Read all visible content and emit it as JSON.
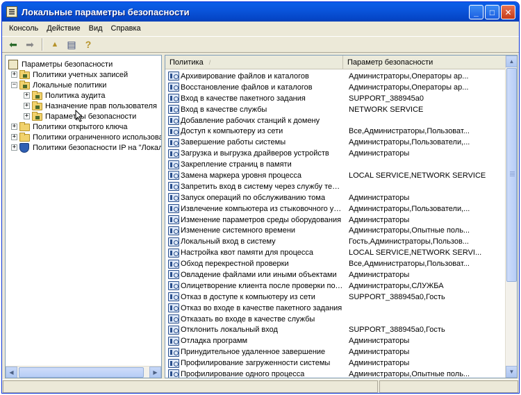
{
  "window": {
    "title": "Локальные параметры безопасности",
    "minimize_glyph": "_",
    "maximize_glyph": "□",
    "close_glyph": "✕"
  },
  "menu": [
    "Консоль",
    "Действие",
    "Вид",
    "Справка"
  ],
  "toolbar": {
    "back_glyph": "⬅",
    "forward_glyph": "➡",
    "up_glyph": "▲",
    "export_glyph": "▤",
    "help_glyph": "?"
  },
  "tree": {
    "root": "Параметры безопасности",
    "items": [
      {
        "label": "Политики учетных записей",
        "expander": "+"
      },
      {
        "label": "Локальные политики",
        "expander": "−"
      },
      {
        "label": "Политика аудита",
        "expander": "+"
      },
      {
        "label": "Назначение прав пользователя",
        "expander": "+"
      },
      {
        "label": "Параметры безопасности",
        "expander": "+"
      },
      {
        "label": "Политики открытого ключа",
        "expander": "+"
      },
      {
        "label": "Политики ограниченного использован",
        "expander": "+"
      },
      {
        "label": "Политики безопасности IP на \"Локальн",
        "expander": "+"
      }
    ]
  },
  "list": {
    "col_policy": "Политика",
    "col_setting": "Параметр безопасности",
    "rows": [
      {
        "policy": "Архивирование файлов и каталогов",
        "setting": "Администраторы,Операторы ар..."
      },
      {
        "policy": "Восстановление файлов и каталогов",
        "setting": "Администраторы,Операторы ар..."
      },
      {
        "policy": "Вход в качестве пакетного задания",
        "setting": "SUPPORT_388945a0"
      },
      {
        "policy": "Вход в качестве службы",
        "setting": "NETWORK SERVICE"
      },
      {
        "policy": "Добавление рабочих станций к домену",
        "setting": ""
      },
      {
        "policy": "Доступ к компьютеру из сети",
        "setting": "Все,Администраторы,Пользоват..."
      },
      {
        "policy": "Завершение работы системы",
        "setting": "Администраторы,Пользователи,..."
      },
      {
        "policy": "Загрузка и выгрузка драйверов устройств",
        "setting": "Администраторы"
      },
      {
        "policy": "Закрепление страниц в памяти",
        "setting": ""
      },
      {
        "policy": "Замена маркера уровня процесса",
        "setting": "LOCAL SERVICE,NETWORK SERVICE"
      },
      {
        "policy": "Запретить вход в систему через службу терм...",
        "setting": ""
      },
      {
        "policy": "Запуск операций по обслуживанию тома",
        "setting": "Администраторы"
      },
      {
        "policy": "Извлечение компьютера из стыковочного узла",
        "setting": "Администраторы,Пользователи,..."
      },
      {
        "policy": "Изменение параметров среды оборудования",
        "setting": "Администраторы"
      },
      {
        "policy": "Изменение системного времени",
        "setting": "Администраторы,Опытные поль..."
      },
      {
        "policy": "Локальный вход в систему",
        "setting": "Гость,Администраторы,Пользов..."
      },
      {
        "policy": "Настройка квот памяти для процесса",
        "setting": "LOCAL SERVICE,NETWORK SERVI..."
      },
      {
        "policy": "Обход перекрестной проверки",
        "setting": "Все,Администраторы,Пользоват..."
      },
      {
        "policy": "Овладение файлами или иными объектами",
        "setting": "Администраторы"
      },
      {
        "policy": "Олицетворение клиента после проверки подл...",
        "setting": "Администраторы,СЛУЖБА"
      },
      {
        "policy": "Отказ в доступе к компьютеру из сети",
        "setting": "SUPPORT_388945a0,Гость"
      },
      {
        "policy": "Отказ во входе в качестве пакетного задания",
        "setting": ""
      },
      {
        "policy": "Отказать во входе в качестве службы",
        "setting": ""
      },
      {
        "policy": "Отклонить локальный вход",
        "setting": "SUPPORT_388945a0,Гость"
      },
      {
        "policy": "Отладка программ",
        "setting": "Администраторы"
      },
      {
        "policy": "Принудительное удаленное завершение",
        "setting": "Администраторы"
      },
      {
        "policy": "Профилирование загруженности системы",
        "setting": "Администраторы"
      },
      {
        "policy": "Профилирование одного процесса",
        "setting": "Администраторы,Опытные поль..."
      }
    ]
  },
  "colors": {
    "titlebar": "#0a55dc",
    "window_bg": "#ece9d8",
    "selection": "#316ac5"
  }
}
